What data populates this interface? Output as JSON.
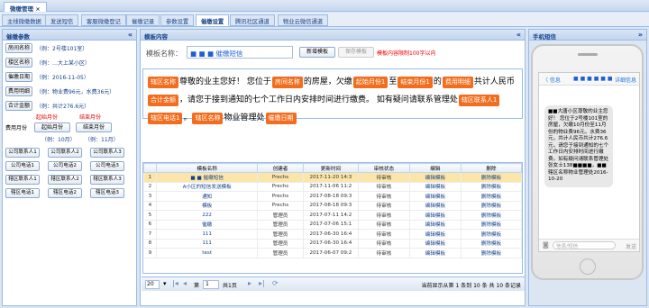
{
  "window": {
    "title": "微缴管理"
  },
  "tabs": [
    "主线微缴数据",
    "发送短信",
    "客服微缴登记",
    "催缴记录",
    "参数设置",
    "催缴设置",
    "腾讯社区通道",
    "物业云微信通道"
  ],
  "left": {
    "title": "催缴参数",
    "params": [
      {
        "label": "房间名称",
        "hint": "（例：2号楼101室）"
      },
      {
        "label": "楼区名称",
        "hint": "（例：…大上某小区）"
      },
      {
        "label": "催缴日期",
        "hint": "（例：2016-11-05）"
      },
      {
        "label": "费用明细",
        "hint": "（例：物业费96元，水费36元）"
      },
      {
        "label": "合计金额",
        "hint": "（例：共计276.6元）"
      }
    ],
    "start_label": "起始月份",
    "end_label": "结束月份",
    "fee_month": "费用月份",
    "start_btn": "起始月份",
    "end_btn": "结束月份",
    "start_hint": "（例：10月）",
    "end_hint": "（例：11月）",
    "grid": [
      "公司联系人1",
      "公司联系人2",
      "公司联系人3",
      "公司电话1",
      "公司电话2",
      "公司电话3",
      "辖区联系人1",
      "辖区联系人2",
      "辖区联系人3",
      "辖区电话1",
      "辖区电话2",
      "辖区电话3"
    ]
  },
  "center": {
    "title": "模板内容",
    "name_label": "模板名称：",
    "name_value": "■ ■ ■ 催缴短信",
    "new_btn": "新增模板",
    "save_btn": "保存模板",
    "limit_note": "模板内容限制100字以内",
    "body": [
      {
        "t": "tag",
        "v": "辖区名称"
      },
      {
        "t": "txt",
        "v": "尊敬的业主您好！ 您位于"
      },
      {
        "t": "tag",
        "v": "房间名称"
      },
      {
        "t": "txt",
        "v": "的房屋，欠缴"
      },
      {
        "t": "tag",
        "v": "起始月份1"
      },
      {
        "t": "txt",
        "v": "至"
      },
      {
        "t": "tag",
        "v": "结束月份1"
      },
      {
        "t": "txt",
        "v": "的"
      },
      {
        "t": "tag",
        "v": "费用明细"
      },
      {
        "t": "txt",
        "v": "共计人民币"
      },
      {
        "t": "tag",
        "v": "合计金额"
      },
      {
        "t": "txt",
        "v": "，请您于接到通知的七个工作日内安排时间进行缴费。 如有疑问请联系管理处"
      },
      {
        "t": "tag",
        "v": "辖区联系人1"
      },
      {
        "t": "tag",
        "v": "辖区电话1"
      },
      {
        "t": "txt",
        "v": "。"
      },
      {
        "t": "tag",
        "v": "辖区名称"
      },
      {
        "t": "txt",
        "v": "物业管理处"
      },
      {
        "t": "tag",
        "v": "催缴日期"
      }
    ],
    "table": {
      "headers": [
        "",
        "模板名称",
        "创建者",
        "更新时间",
        "审核状态",
        "编辑",
        "删除"
      ],
      "rows": [
        [
          "1",
          "■ ■ 催缴短信",
          "Prechs",
          "2017-11-20 14:3",
          "待审核",
          "编辑模板",
          "删除模板"
        ],
        [
          "2",
          "A小区的短信发送模板",
          "Prechs",
          "2017-11-06 11:2",
          "待审核",
          "编辑模板",
          "删除模板"
        ],
        [
          "3",
          "通知",
          "Prechs",
          "2017-08-18 09:3",
          "待审核",
          "编辑模板",
          "删除模板"
        ],
        [
          "4",
          "模板",
          "Prechs",
          "2017-08-18 09:3",
          "待审核",
          "编辑模板",
          "删除模板"
        ],
        [
          "5",
          "222",
          "管理员",
          "2017-07-11 14:2",
          "待审核",
          "编辑模板",
          "删除模板"
        ],
        [
          "6",
          "催缴",
          "管理员",
          "2017-07-06 15:1",
          "待审核",
          "编辑模板",
          "删除模板"
        ],
        [
          "7",
          "111",
          "管理员",
          "2017-06-30 16:4",
          "待审核",
          "编辑模板",
          "删除模板"
        ],
        [
          "8",
          "111",
          "管理员",
          "2017-06-30 16:4",
          "待审核",
          "编辑模板",
          "删除模板"
        ],
        [
          "9",
          "test",
          "管理员",
          "2017-06-07 09:2",
          "待审核",
          "编辑模板",
          "删除模板"
        ]
      ]
    },
    "pager": {
      "size": "20",
      "page_pre": "第",
      "page": "1",
      "page_post": "共1页",
      "info": "当前显示从第 1 条到 10 条 共 10 条记录"
    }
  },
  "right": {
    "title": "手机短信",
    "back": "〈 信息",
    "contact": "■ ■ ■ ■ ■ ■",
    "detail": "详细信息",
    "sms": "■■大唐小区尊敬的业主您好！ 您位于2号楼101室的房屋，欠缴10月份至11月份的物业费96元，水费36元，共计人民币共计276.6元，请您于接到通知的七个工作日内安排时间进行缴费。如有疑问请联系管理处张女士138■■■■，■■辖区名称物业管理处2016-10-20",
    "input_ph": "信息/短信",
    "send": "发送"
  },
  "colors": {
    "accent": "#15428b",
    "tag": "#f26d1d"
  }
}
